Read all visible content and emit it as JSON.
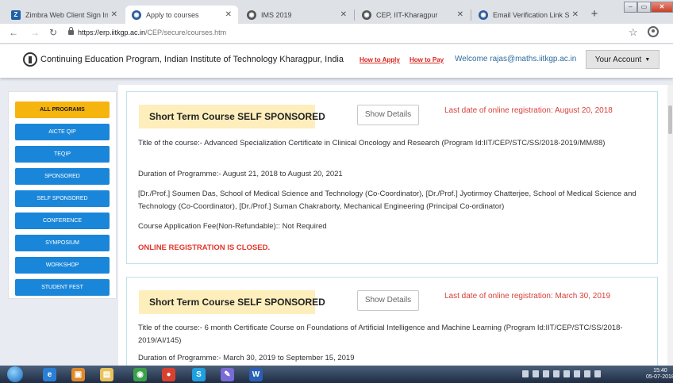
{
  "browser": {
    "tabs": [
      {
        "title": "Zimbra Web Client Sign In",
        "color": "#1f5fa8",
        "glyph": "Z"
      },
      {
        "title": "Apply to courses",
        "color": "#2c5c9a",
        "glyph": "◉"
      },
      {
        "title": "IMS 2019",
        "color": "#555555",
        "glyph": "◉"
      },
      {
        "title": "CEP, IIT-Kharagpur",
        "color": "#555555",
        "glyph": "◉"
      },
      {
        "title": "Email Verification Link Sent",
        "color": "#2c5c9a",
        "glyph": "◉"
      }
    ],
    "active_tab": 1,
    "url_host": "https://erp.iitkgp.ac.in",
    "url_path": "/CEP/secure/courses.htm"
  },
  "header": {
    "site_title": "Continuing Education Program, Indian Institute of Technology Kharagpur, India",
    "how_to_apply": "How to Apply",
    "how_to_pay": "How to Pay",
    "welcome": "Welcome rajas@maths.iitkgp.ac.in",
    "account_label": "Your Account"
  },
  "sidebar": {
    "items": [
      {
        "label": "ALL PROGRAMS",
        "active": true
      },
      {
        "label": "AICTE QIP"
      },
      {
        "label": "TEQIP"
      },
      {
        "label": "SPONSORED"
      },
      {
        "label": "SELF SPONSORED"
      },
      {
        "label": "CONFERENCE"
      },
      {
        "label": "SYMPOSIUM"
      },
      {
        "label": "WORKSHOP"
      },
      {
        "label": "STUDENT FEST"
      }
    ]
  },
  "courses": [
    {
      "type": "Short Term Course SELF SPONSORED",
      "show_details": "Show Details",
      "last_date": "Last date of online registration: August 20, 2018",
      "title": "Title of the course:- Advanced Specialization Certificate in Clinical Oncology and Research (Program Id:IIT/CEP/STC/SS/2018-2019/MM/88)",
      "duration": "Duration of Programme:- August 21, 2018 to August 20, 2021",
      "coordinators": "[Dr./Prof.] Soumen Das, School of Medical Science and Technology (Co-Coordinator), [Dr./Prof.] Jyotirmoy Chatterjee, School of Medical Science and Technology (Co-Coordinator), [Dr./Prof.] Suman Chakraborty, Mechanical Engineering (Principal Co-ordinator)",
      "fee": "Course Application Fee(Non-Refundable):: Not Required",
      "status": "ONLINE REGISTRATION IS CLOSED."
    },
    {
      "type": "Short Term Course SELF SPONSORED",
      "show_details": "Show Details",
      "last_date": "Last date of online registration: March 30, 2019",
      "title": "Title of the course:- 6 month Certificate Course on Foundations of Artificial Intelligence and Machine Learning (Program Id:IIT/CEP/STC/SS/2018-2019/AI/145)",
      "duration": "Duration of Programme:- March 30, 2019 to September 15, 2019"
    }
  ],
  "taskbar": {
    "apps": [
      {
        "glyph": "e",
        "color": "#2a7fd4"
      },
      {
        "glyph": "▣",
        "color": "#e0892a"
      },
      {
        "glyph": "▤",
        "color": "#e8c25a"
      },
      {
        "glyph": "◉",
        "color": "#3aa14a"
      },
      {
        "glyph": "●",
        "color": "#d9412f"
      },
      {
        "glyph": "S",
        "color": "#1fa0e0"
      },
      {
        "glyph": "✎",
        "color": "#7a6ad8"
      },
      {
        "glyph": "W",
        "color": "#2b5fb4"
      }
    ],
    "time": "15:40",
    "date": "05-07-2018"
  }
}
